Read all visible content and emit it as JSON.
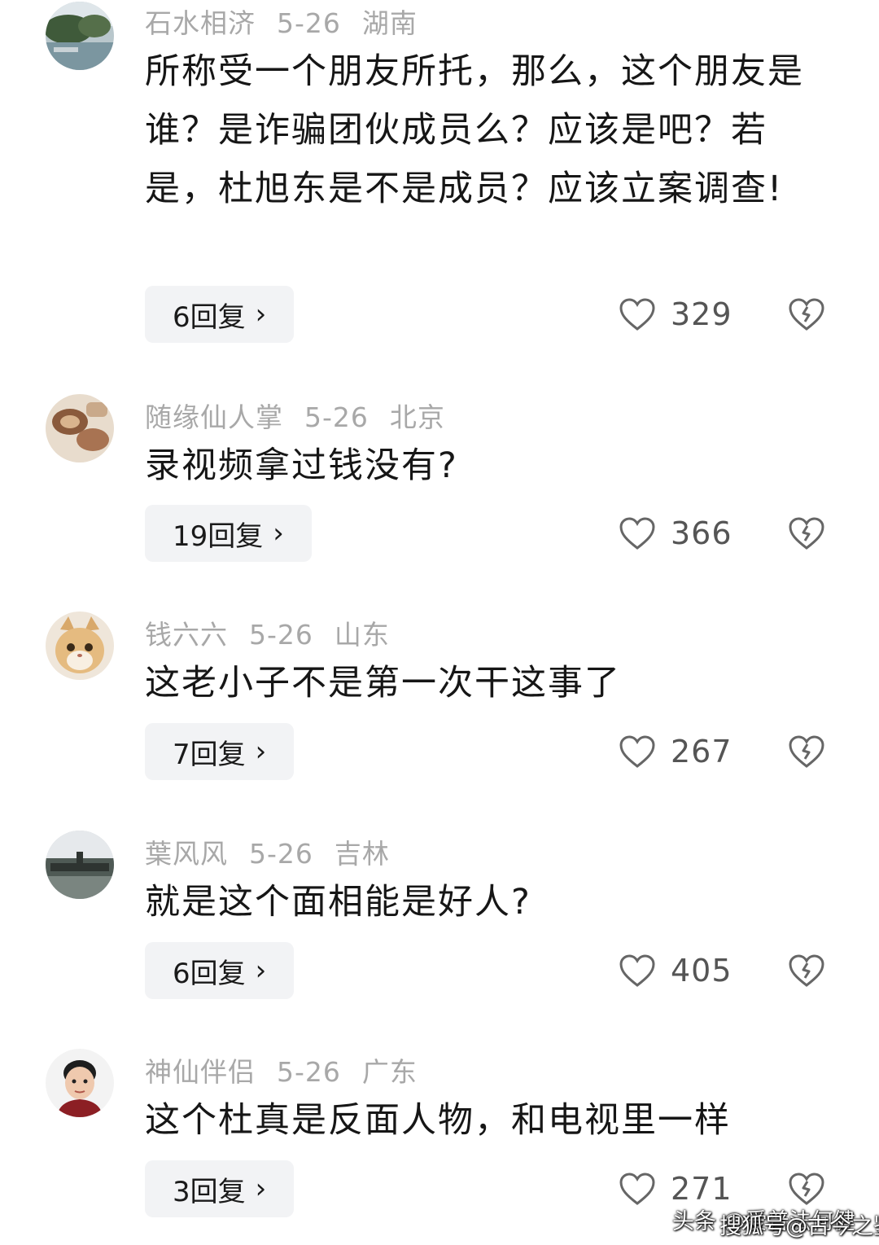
{
  "comments": [
    {
      "user": "石水相济",
      "date": "5-26",
      "location": "湖南",
      "text": "所称受一个朋友所托，那么，这个朋友是谁？是诈骗团伙成员么？应该是吧？若是，杜旭东是不是成员？应该立案调查!",
      "replies": "6回复",
      "likes": "329",
      "avatar_icon": "landscape-avatar"
    },
    {
      "user": "随缘仙人掌",
      "date": "5-26",
      "location": "北京",
      "text": "录视频拿过钱没有?",
      "replies": "19回复",
      "likes": "366",
      "avatar_icon": "food-avatar"
    },
    {
      "user": "钱六六",
      "date": "5-26",
      "location": "山东",
      "text": "这老小子不是第一次干这事了",
      "replies": "7回复",
      "likes": "267",
      "avatar_icon": "cat-avatar"
    },
    {
      "user": "葉风风",
      "date": "5-26",
      "location": "吉林",
      "text": "就是这个面相能是好人?",
      "replies": "6回复",
      "likes": "405",
      "avatar_icon": "aircraft-avatar"
    },
    {
      "user": "神仙伴侣",
      "date": "5-26",
      "location": "广东",
      "text": "这个杜真是反面人物，和电视里一样",
      "replies": "3回复",
      "likes": "271",
      "avatar_icon": "child-photo-avatar"
    }
  ],
  "reply_chevron": "›",
  "watermark": {
    "line1": "头条 @爱普法何健",
    "line2": "搜狐号@古今之鉴"
  },
  "colors": {
    "meta_gray": "#a8a8a8",
    "reply_bg": "#f2f3f5",
    "icon_gray": "#666666"
  }
}
